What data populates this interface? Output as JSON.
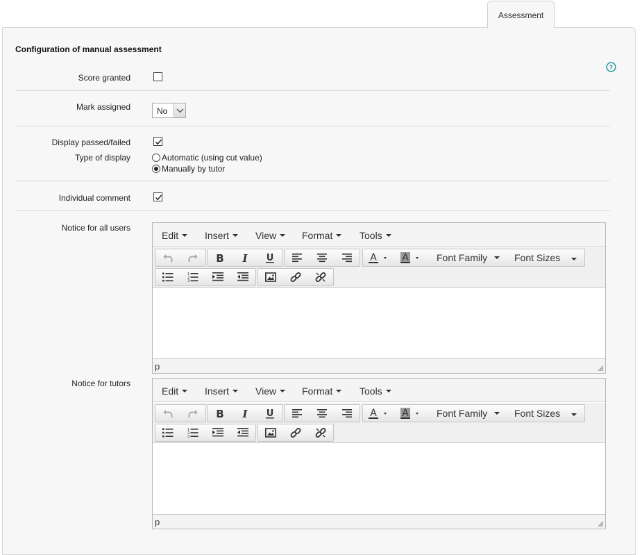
{
  "tab": {
    "label": "Assessment"
  },
  "section": {
    "title": "Configuration of manual assessment"
  },
  "fields": {
    "score_granted": {
      "label": "Score granted",
      "checked": false
    },
    "mark_assigned": {
      "label": "Mark assigned",
      "value": "No"
    },
    "display_passed_failed": {
      "label": "Display passed/failed",
      "checked": true
    },
    "type_of_display": {
      "label": "Type of display",
      "options": [
        "Automatic (using cut value)",
        "Manually by tutor"
      ],
      "selected": "Manually by tutor"
    },
    "individual_comment": {
      "label": "Individual comment",
      "checked": true
    },
    "notice_all_users": {
      "label": "Notice for all users"
    },
    "notice_tutors": {
      "label": "Notice for tutors"
    }
  },
  "editor": {
    "menu": [
      "Edit",
      "Insert",
      "View",
      "Format",
      "Tools"
    ],
    "font_family": "Font Family",
    "font_sizes": "Font Sizes",
    "status_path": "p",
    "icons": [
      "undo-icon",
      "redo-icon",
      "bold-icon",
      "italic-icon",
      "underline-icon",
      "align-left-icon",
      "align-center-icon",
      "align-right-icon",
      "text-color-icon",
      "background-color-icon",
      "bullet-list-icon",
      "numbered-list-icon",
      "indent-icon",
      "outdent-icon",
      "image-icon",
      "link-icon",
      "unlink-icon"
    ]
  },
  "colors": {
    "panel_bg": "#f7f7f7",
    "help_icon": "#1e9a9a"
  }
}
